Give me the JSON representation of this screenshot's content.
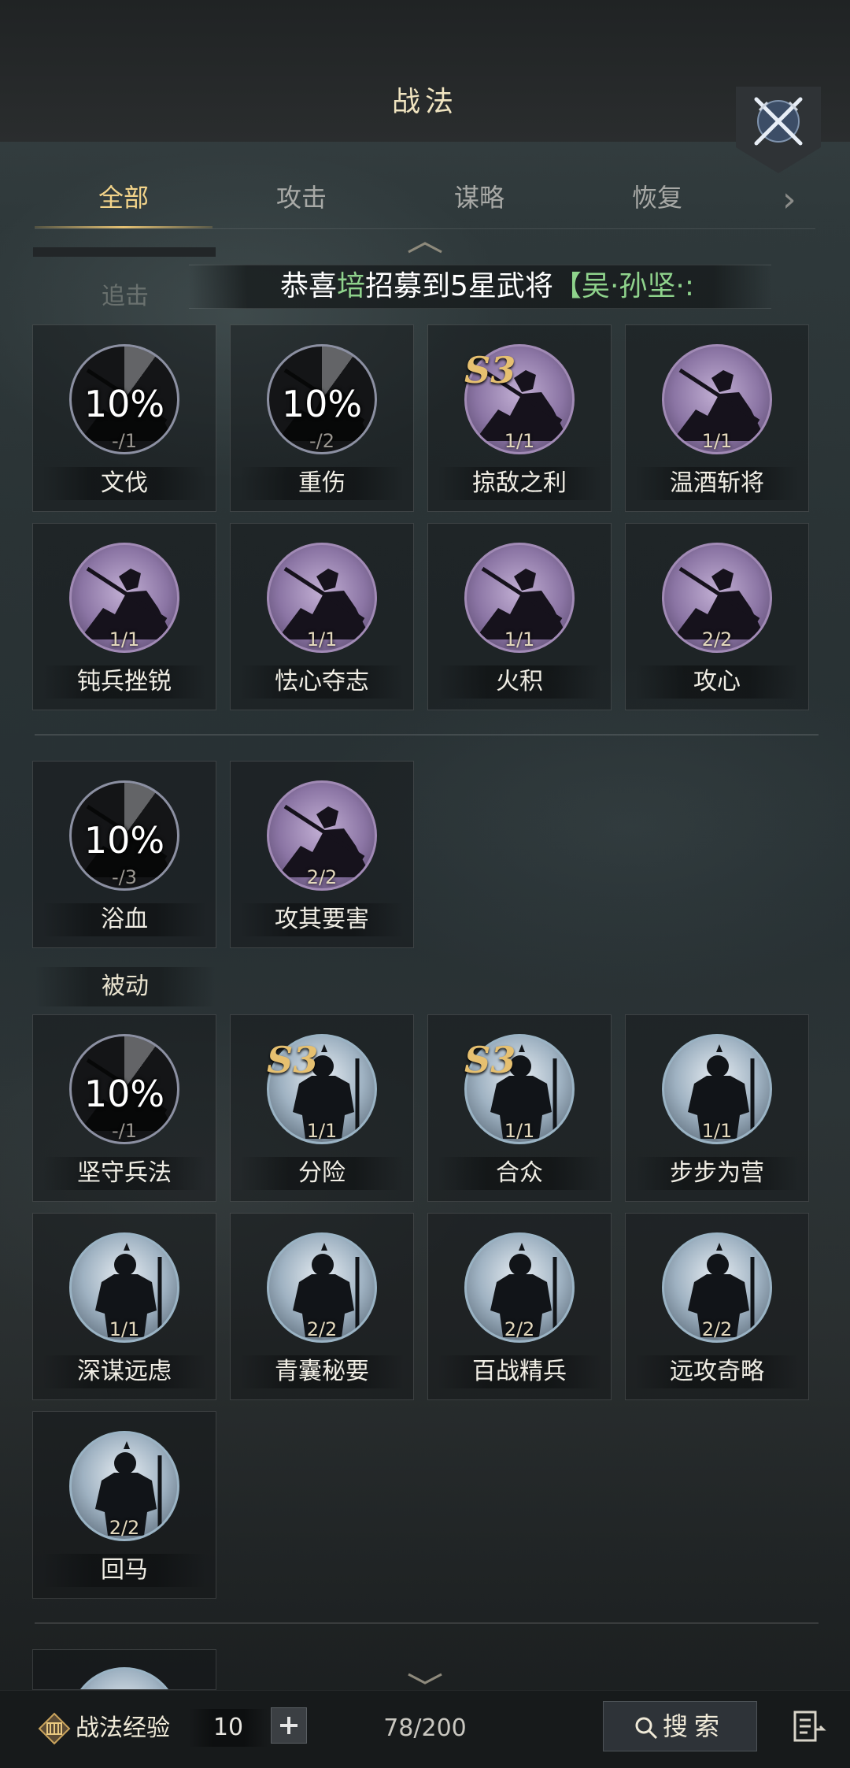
{
  "header": {
    "title": "战法"
  },
  "tabs": [
    "全部",
    "攻击",
    "谋略",
    "恢复"
  ],
  "broadcast": {
    "prefix": "恭喜",
    "name": "培",
    "mid": "招募到5星武将",
    "tail": "【吴·孙坚·:"
  },
  "sections": {
    "pursuit": "追击",
    "passive": "被动"
  },
  "pursuit_skills": [
    {
      "name": "文伐",
      "level": "-/1",
      "cooldown_pct": "10%",
      "s3": false
    },
    {
      "name": "重伤",
      "level": "-/2",
      "cooldown_pct": "10%",
      "s3": false
    },
    {
      "name": "掠敌之利",
      "level": "1/1",
      "cooldown_pct": "",
      "s3": true,
      "s3_label": "S3"
    },
    {
      "name": "温酒斩将",
      "level": "1/1",
      "cooldown_pct": "",
      "s3": false
    },
    {
      "name": "钝兵挫锐",
      "level": "1/1",
      "cooldown_pct": "",
      "s3": false
    },
    {
      "name": "怯心夺志",
      "level": "1/1",
      "cooldown_pct": "",
      "s3": false
    },
    {
      "name": "火积",
      "level": "1/1",
      "cooldown_pct": "",
      "s3": false
    },
    {
      "name": "攻心",
      "level": "2/2",
      "cooldown_pct": "",
      "s3": false
    },
    {
      "name": "浴血",
      "level": "-/3",
      "cooldown_pct": "10%",
      "s3": false
    },
    {
      "name": "攻其要害",
      "level": "2/2",
      "cooldown_pct": "",
      "s3": false
    }
  ],
  "passive_skills": [
    {
      "name": "坚守兵法",
      "level": "-/1",
      "cooldown_pct": "10%",
      "s3": false
    },
    {
      "name": "分险",
      "level": "1/1",
      "cooldown_pct": "",
      "s3": true,
      "s3_label": "S3"
    },
    {
      "name": "合众",
      "level": "1/1",
      "cooldown_pct": "",
      "s3": true,
      "s3_label": "S3"
    },
    {
      "name": "步步为营",
      "level": "1/1",
      "cooldown_pct": "",
      "s3": false
    },
    {
      "name": "深谋远虑",
      "level": "1/1",
      "cooldown_pct": "",
      "s3": false
    },
    {
      "name": "青囊秘要",
      "level": "2/2",
      "cooldown_pct": "",
      "s3": false
    },
    {
      "name": "百战精兵",
      "level": "2/2",
      "cooldown_pct": "",
      "s3": false
    },
    {
      "name": "远攻奇略",
      "level": "2/2",
      "cooldown_pct": "",
      "s3": false
    },
    {
      "name": "回马",
      "level": "2/2",
      "cooldown_pct": "",
      "s3": false
    }
  ],
  "footer": {
    "exp_label": "战法经验",
    "exp_value": "10",
    "count": "78/200",
    "search_label": "搜索"
  },
  "colors": {
    "accent": "#e6c273",
    "broadcast_green": "#8fd38c",
    "s3_gold": "#e6c070"
  }
}
